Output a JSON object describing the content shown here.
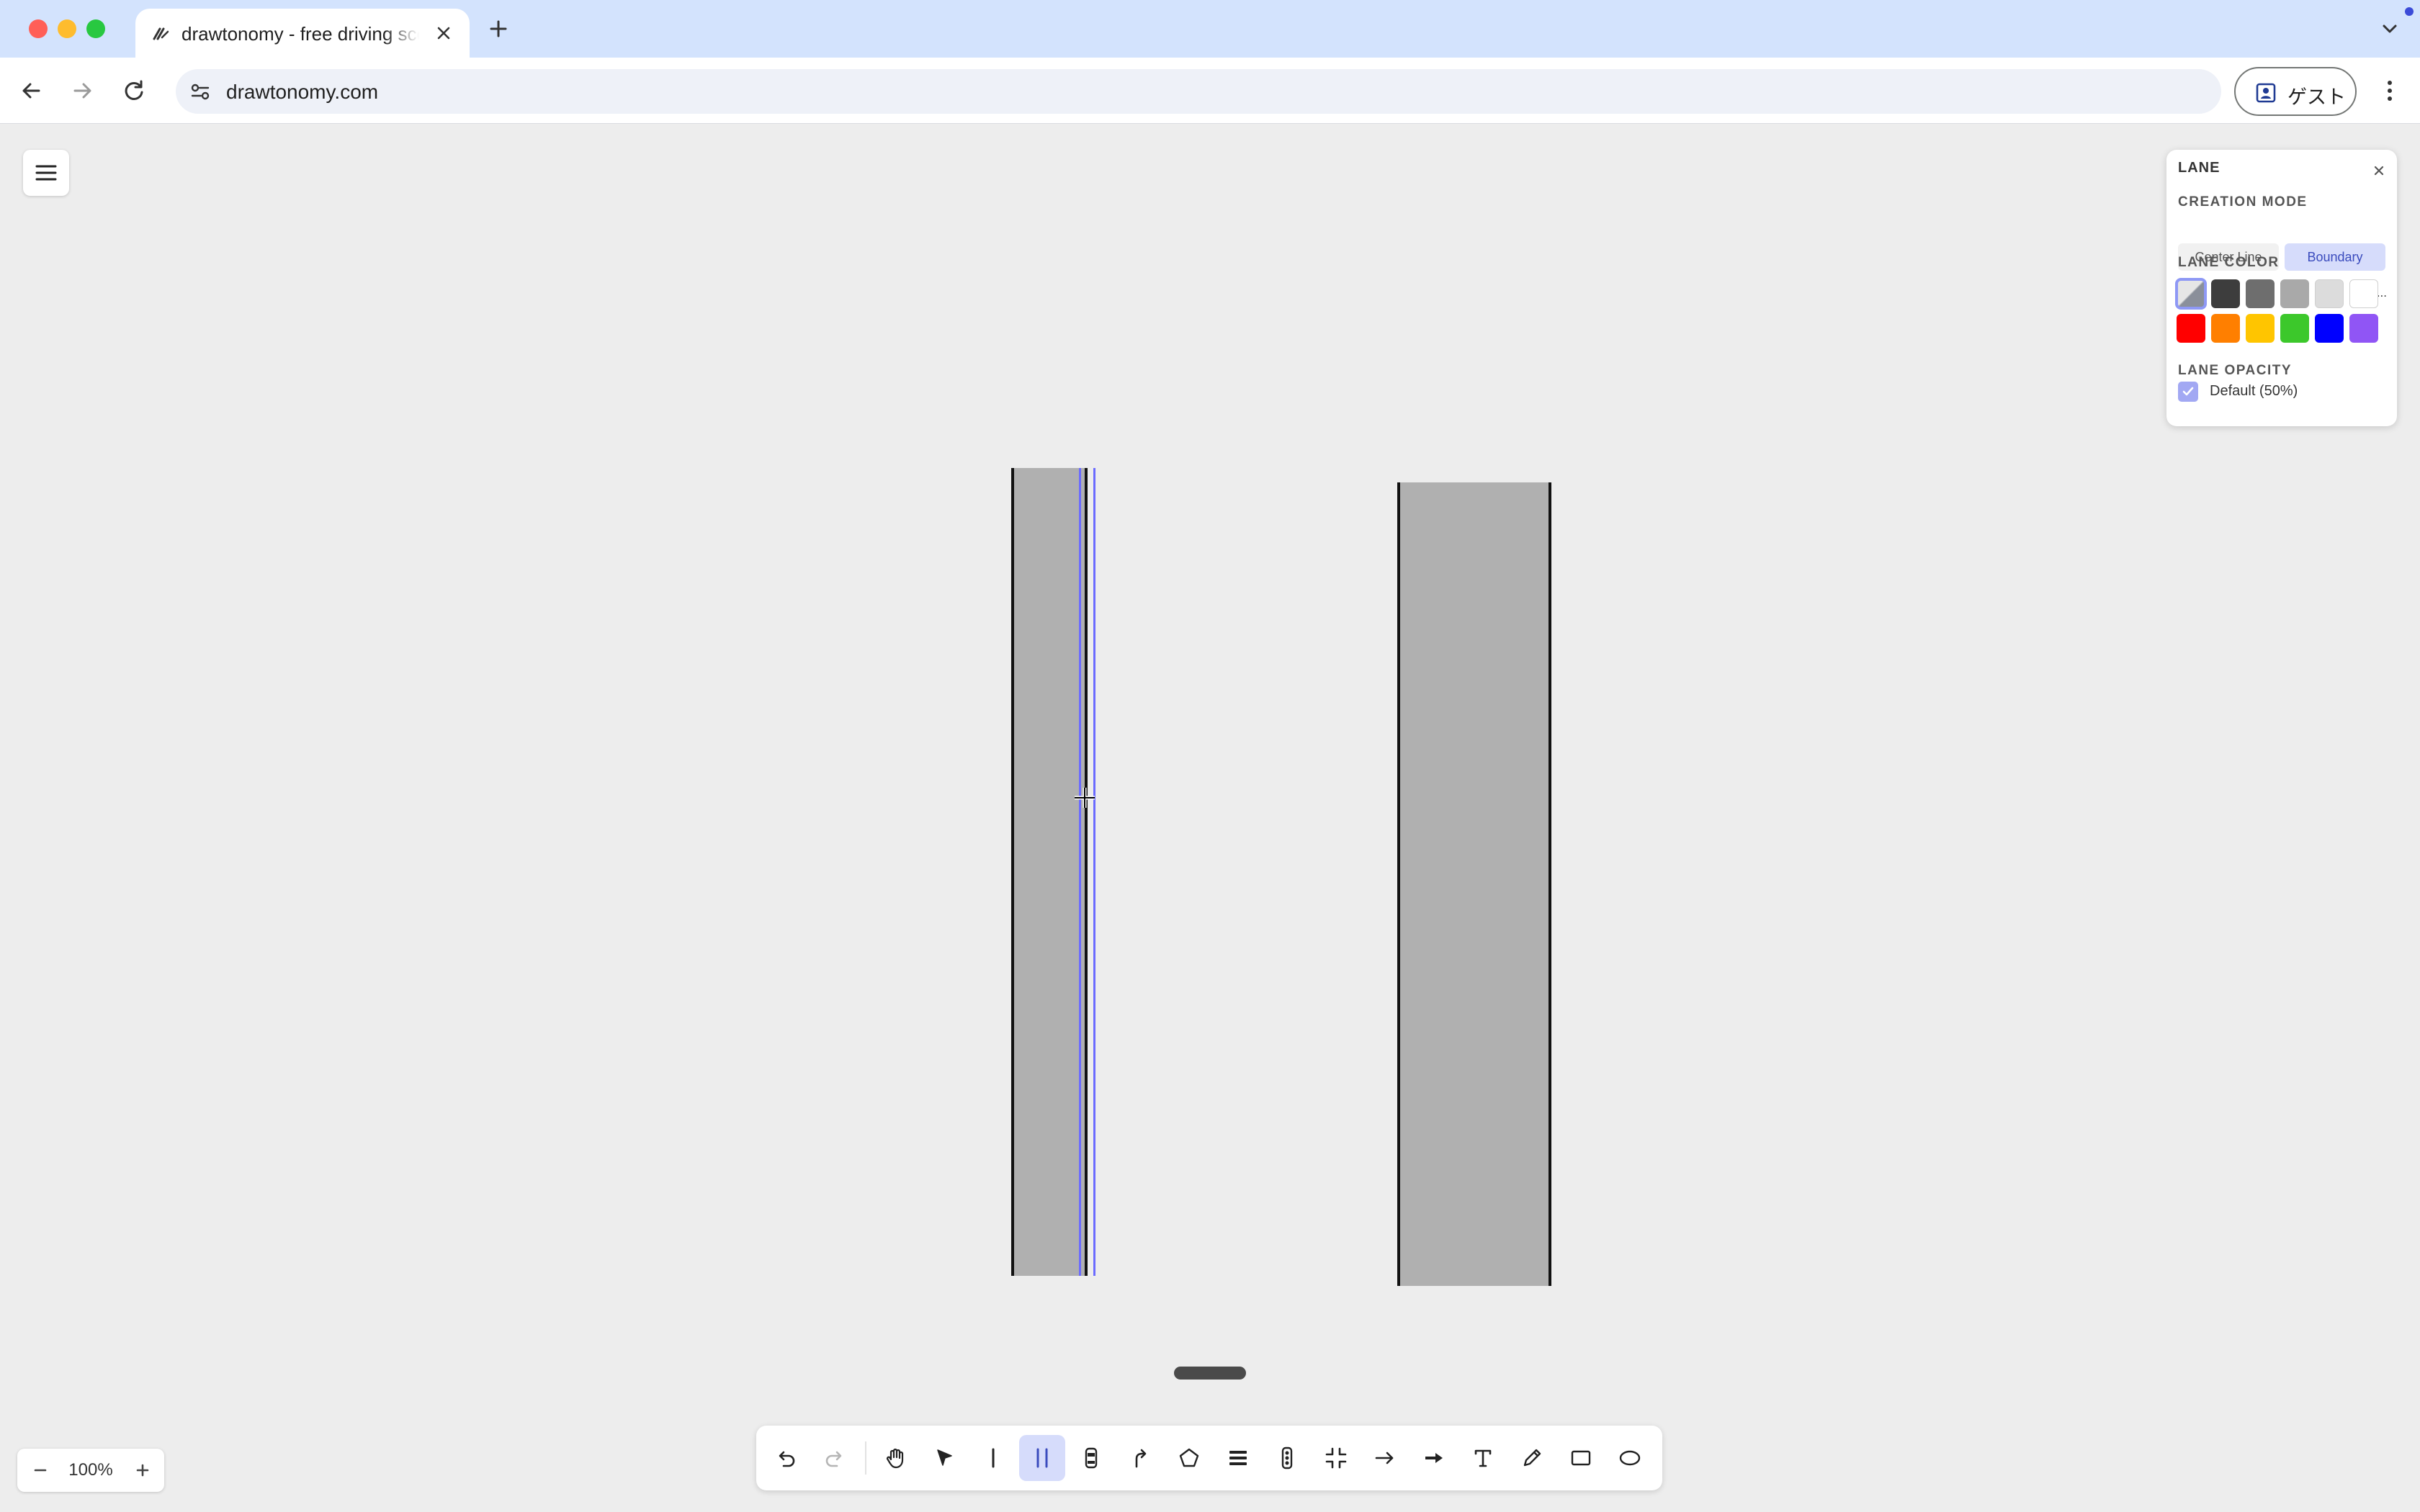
{
  "browser": {
    "tab_title": "drawtonomy - free driving scene editor",
    "url": "drawtonomy.com",
    "profile_label": "ゲスト"
  },
  "panel": {
    "title": "LANE",
    "creation_mode_label": "CREATION MODE",
    "modes": [
      "Center Line",
      "Boundary"
    ],
    "selected_mode": "Boundary",
    "lane_color_label": "LANE COLOR",
    "more_label": "More...",
    "colors": [
      "#8a8f9a",
      "#3d3d3d",
      "#6e6e6e",
      "#a9a9a9",
      "#dcdcdc",
      "#ffffff",
      "#ff0000",
      "#ff7f00",
      "#ffc500",
      "#3cc82b",
      "#0000ff",
      "#9055f5"
    ],
    "selected_color_index": 0,
    "lane_opacity_label": "LANE OPACITY",
    "opacity_option": "Default (50%)",
    "opacity_checked": true
  },
  "zoom": {
    "value": "100%"
  },
  "tools": [
    {
      "name": "undo",
      "icon": "undo-icon"
    },
    {
      "name": "redo",
      "icon": "redo-icon"
    },
    {
      "name": "hand",
      "icon": "hand-icon"
    },
    {
      "name": "select",
      "icon": "cursor-arrow-icon"
    },
    {
      "name": "line",
      "icon": "line-icon"
    },
    {
      "name": "lane",
      "icon": "lane-icon",
      "active": true
    },
    {
      "name": "vehicle",
      "icon": "car-icon"
    },
    {
      "name": "path",
      "icon": "turn-path-icon"
    },
    {
      "name": "polygon",
      "icon": "pentagon-icon"
    },
    {
      "name": "crosswalk",
      "icon": "crosswalk-icon"
    },
    {
      "name": "traffic-light",
      "icon": "traffic-light-icon"
    },
    {
      "name": "intersection",
      "icon": "intersection-icon"
    },
    {
      "name": "arrow",
      "icon": "arrow-icon"
    },
    {
      "name": "thick-arrow",
      "icon": "thick-arrow-icon"
    },
    {
      "name": "text",
      "icon": "text-icon"
    },
    {
      "name": "pencil",
      "icon": "pencil-icon"
    },
    {
      "name": "rectangle",
      "icon": "rectangle-icon"
    },
    {
      "name": "ellipse",
      "icon": "ellipse-icon"
    }
  ]
}
